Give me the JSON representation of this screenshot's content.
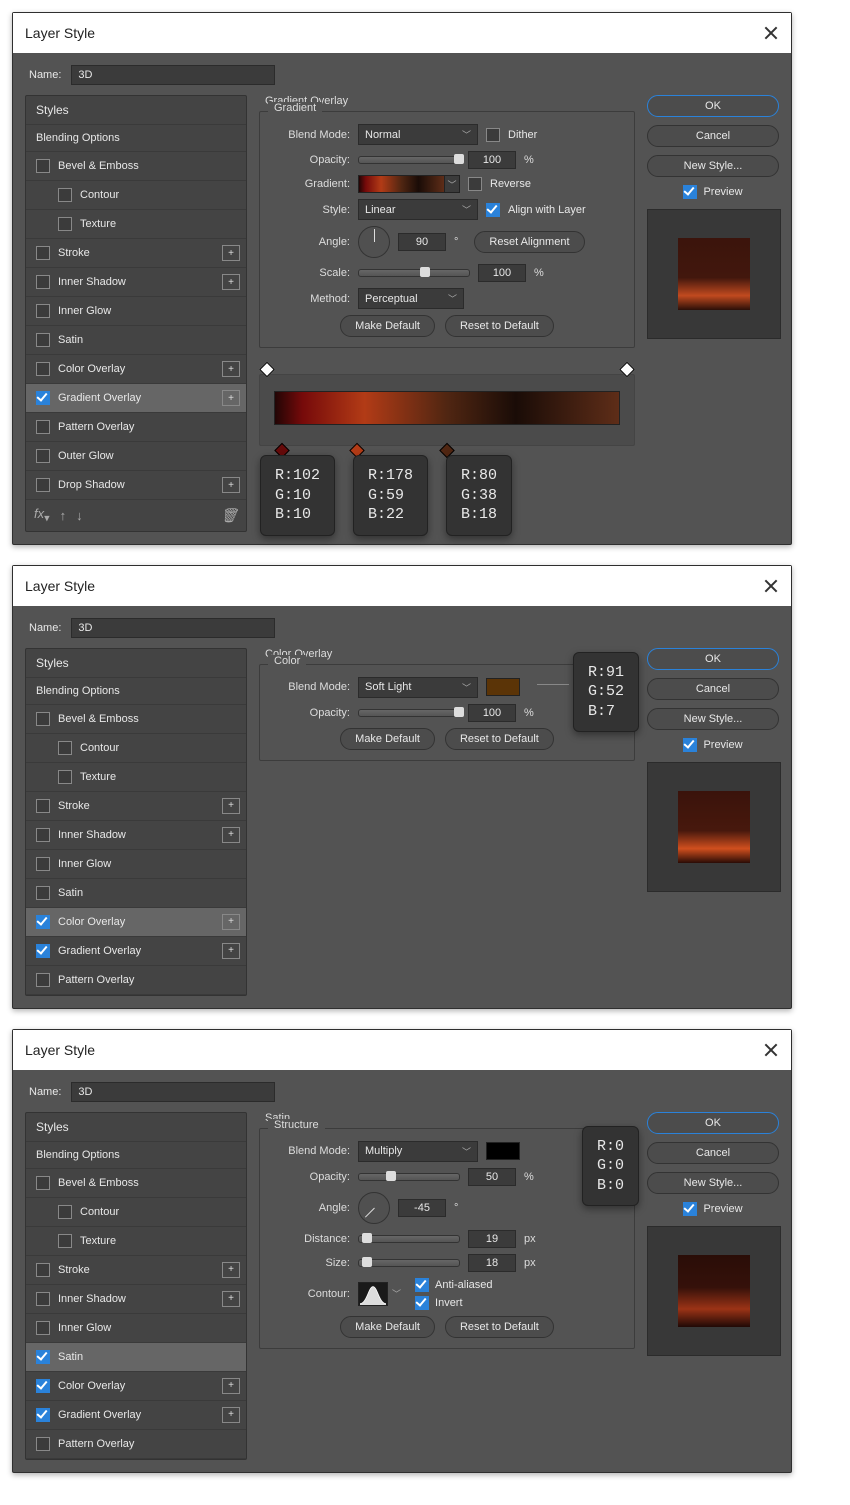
{
  "dialog1": {
    "title": "Layer Style",
    "name_lbl": "Name:",
    "name_val": "3D",
    "side": {
      "ok": "OK",
      "cancel": "Cancel",
      "newstyle": "New Style...",
      "preview": "Preview"
    },
    "styles": {
      "head": "Styles",
      "rows": [
        {
          "label": "Blending Options",
          "type": "head"
        },
        {
          "label": "Bevel & Emboss",
          "chk": false,
          "plus": false
        },
        {
          "label": "Contour",
          "chk": false,
          "plus": false,
          "indent": true
        },
        {
          "label": "Texture",
          "chk": false,
          "plus": false,
          "indent": true
        },
        {
          "label": "Stroke",
          "chk": false,
          "plus": true
        },
        {
          "label": "Inner Shadow",
          "chk": false,
          "plus": true
        },
        {
          "label": "Inner Glow",
          "chk": false,
          "plus": false
        },
        {
          "label": "Satin",
          "chk": false,
          "plus": false
        },
        {
          "label": "Color Overlay",
          "chk": false,
          "plus": true
        },
        {
          "label": "Gradient Overlay",
          "chk": true,
          "plus": true,
          "selected": true
        },
        {
          "label": "Pattern Overlay",
          "chk": false,
          "plus": false
        },
        {
          "label": "Outer Glow",
          "chk": false,
          "plus": false
        },
        {
          "label": "Drop Shadow",
          "chk": false,
          "plus": true
        }
      ]
    },
    "panel": {
      "title": "Gradient Overlay",
      "group": "Gradient",
      "blend_lbl": "Blend Mode:",
      "blend_val": "Normal",
      "dither": "Dither",
      "opacity_lbl": "Opacity:",
      "opacity_val": "100",
      "pct": "%",
      "gradient_lbl": "Gradient:",
      "reverse": "Reverse",
      "style_lbl": "Style:",
      "style_val": "Linear",
      "align": "Align with Layer",
      "angle_lbl": "Angle:",
      "angle_val": "90",
      "deg": "°",
      "reset_align": "Reset Alignment",
      "scale_lbl": "Scale:",
      "scale_val": "100",
      "method_lbl": "Method:",
      "method_val": "Perceptual",
      "make_default": "Make Default",
      "reset_default": "Reset to Default",
      "stops": [
        {
          "pos": 6,
          "r": 102,
          "g": 10,
          "b": 10,
          "hex": "#660a0a"
        },
        {
          "pos": 26,
          "r": 178,
          "g": 59,
          "b": 22,
          "hex": "#b23b16"
        },
        {
          "pos": 50,
          "r": 80,
          "g": 38,
          "b": 18,
          "hex": "#502612"
        }
      ],
      "grad_css": "linear-gradient(90deg,#220505 0%,#760a0a 8%,#b23b16 26%,#502612 50%,#1a0c07 70%,#5e2d18 100%)",
      "preview_css": "linear-gradient(180deg,#3b140c 0%,#42170d 55%,#c14a1f 80%,#2b0f08 100%)"
    }
  },
  "dialog2": {
    "title": "Layer Style",
    "name_lbl": "Name:",
    "name_val": "3D",
    "side": {
      "ok": "OK",
      "cancel": "Cancel",
      "newstyle": "New Style...",
      "preview": "Preview"
    },
    "styles": {
      "head": "Styles",
      "rows": [
        {
          "label": "Blending Options",
          "type": "head"
        },
        {
          "label": "Bevel & Emboss",
          "chk": false
        },
        {
          "label": "Contour",
          "chk": false,
          "indent": true
        },
        {
          "label": "Texture",
          "chk": false,
          "indent": true
        },
        {
          "label": "Stroke",
          "chk": false,
          "plus": true
        },
        {
          "label": "Inner Shadow",
          "chk": false,
          "plus": true
        },
        {
          "label": "Inner Glow",
          "chk": false
        },
        {
          "label": "Satin",
          "chk": false
        },
        {
          "label": "Color Overlay",
          "chk": true,
          "plus": true,
          "selected": true
        },
        {
          "label": "Gradient Overlay",
          "chk": true,
          "plus": true
        },
        {
          "label": "Pattern Overlay",
          "chk": false
        }
      ]
    },
    "panel": {
      "title": "Color Overlay",
      "group": "Color",
      "blend_lbl": "Blend Mode:",
      "blend_val": "Soft Light",
      "opacity_lbl": "Opacity:",
      "opacity_val": "100",
      "pct": "%",
      "make_default": "Make Default",
      "reset_default": "Reset to Default",
      "color": {
        "r": 91,
        "g": 52,
        "b": 7,
        "hex": "#5b3407"
      },
      "preview_css": "linear-gradient(180deg,#3a130b 0%,#47180d 55%,#d04f1e 80%,#2a0c06 100%)"
    }
  },
  "dialog3": {
    "title": "Layer Style",
    "name_lbl": "Name:",
    "name_val": "3D",
    "side": {
      "ok": "OK",
      "cancel": "Cancel",
      "newstyle": "New Style...",
      "preview": "Preview"
    },
    "styles": {
      "head": "Styles",
      "rows": [
        {
          "label": "Blending Options",
          "type": "head"
        },
        {
          "label": "Bevel & Emboss",
          "chk": false
        },
        {
          "label": "Contour",
          "chk": false,
          "indent": true
        },
        {
          "label": "Texture",
          "chk": false,
          "indent": true
        },
        {
          "label": "Stroke",
          "chk": false,
          "plus": true
        },
        {
          "label": "Inner Shadow",
          "chk": false,
          "plus": true
        },
        {
          "label": "Inner Glow",
          "chk": false
        },
        {
          "label": "Satin",
          "chk": true,
          "selected": true
        },
        {
          "label": "Color Overlay",
          "chk": true,
          "plus": true
        },
        {
          "label": "Gradient Overlay",
          "chk": true,
          "plus": true
        },
        {
          "label": "Pattern Overlay",
          "chk": false
        }
      ]
    },
    "panel": {
      "title": "Satin",
      "group": "Structure",
      "blend_lbl": "Blend Mode:",
      "blend_val": "Multiply",
      "opacity_lbl": "Opacity:",
      "opacity_val": "50",
      "pct": "%",
      "angle_lbl": "Angle:",
      "angle_val": "-45",
      "deg": "°",
      "distance_lbl": "Distance:",
      "distance_val": "19",
      "px": "px",
      "size_lbl": "Size:",
      "size_val": "18",
      "contour_lbl": "Contour:",
      "aa": "Anti-aliased",
      "invert": "Invert",
      "make_default": "Make Default",
      "reset_default": "Reset to Default",
      "color": {
        "r": 0,
        "g": 0,
        "b": 0,
        "hex": "#000000"
      },
      "preview_css": "linear-gradient(180deg,#2a0d07 0%,#35110a 45%,#9b3316 75%,#200906 100%)"
    }
  }
}
